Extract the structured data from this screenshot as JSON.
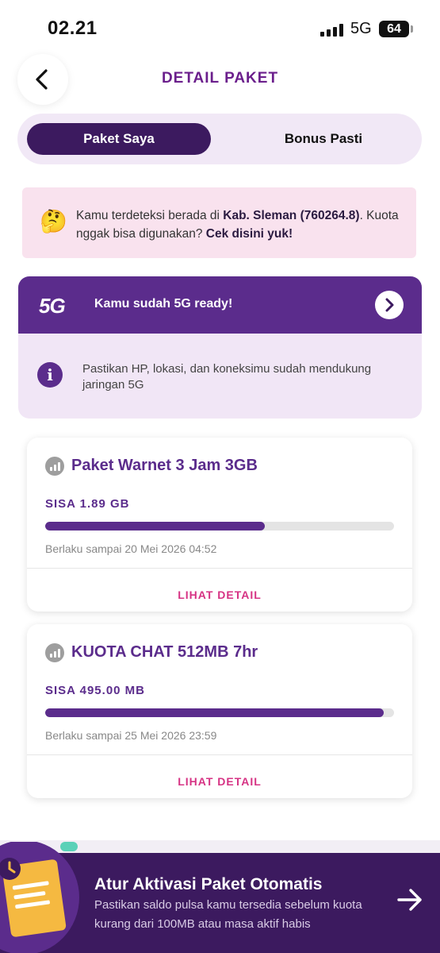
{
  "status_bar": {
    "time": "02.21",
    "network": "5G",
    "battery": "64"
  },
  "header": {
    "title": "DETAIL PAKET"
  },
  "tabs": [
    {
      "label": "Paket Saya",
      "active": true
    },
    {
      "label": "Bonus Pasti",
      "active": false
    }
  ],
  "notice": {
    "emoji": "🤔",
    "part1": "Kamu terdeteksi berada di ",
    "location": "Kab. Sleman (760264.8)",
    "part2": ". Kuota nggak bisa digunakan? ",
    "link": "Cek disini yuk!"
  },
  "g5": {
    "logo": "5G",
    "title": "Kamu sudah 5G ready!",
    "info_icon": "i",
    "description": "Pastikan HP, lokasi, dan koneksimu sudah mendukung jaringan 5G"
  },
  "packages": [
    {
      "name": "Paket Warnet 3 Jam 3GB",
      "remaining": "SISA 1.89 GB",
      "remaining_fraction": 0.63,
      "valid_until": "Berlaku sampai 20 Mei 2026 04:52",
      "detail_label": "LIHAT DETAIL"
    },
    {
      "name": "KUOTA CHAT 512MB 7hr",
      "remaining": "SISA 495.00 MB",
      "remaining_fraction": 0.97,
      "valid_until": "Berlaku sampai 25 Mei 2026 23:59",
      "detail_label": "LIHAT DETAIL"
    }
  ],
  "banner": {
    "title": "Atur Aktivasi Paket Otomatis",
    "subtitle": "Pastikan saldo pulsa kamu tersedia sebelum kuota kurang dari 100MB atau masa aktif habis"
  },
  "colors": {
    "brand_purple": "#5b2c8c",
    "dark_purple": "#3c1a5f",
    "accent_pink": "#d63384",
    "notice_bg": "#f9e2ee"
  },
  "icons": {
    "back": "chevron-left-icon",
    "g5_next": "chevron-right-icon",
    "info": "info-icon",
    "package": "signal-bars-icon",
    "banner_arrow": "arrow-right-icon"
  }
}
